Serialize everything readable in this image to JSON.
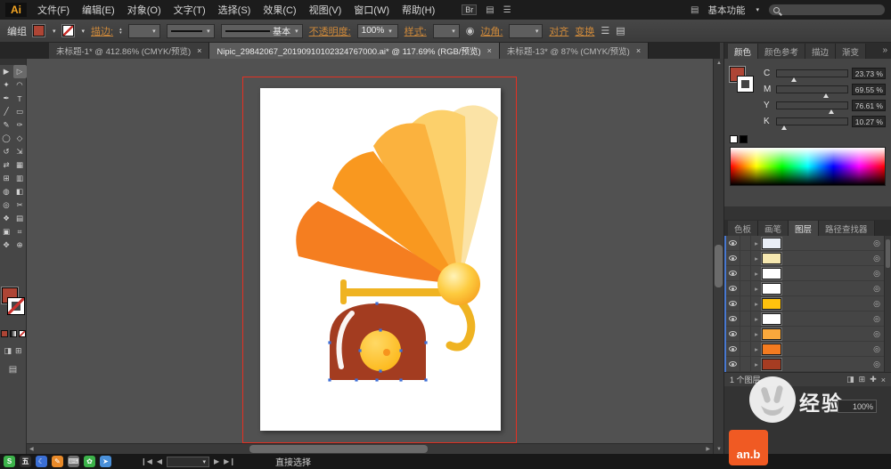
{
  "app": {
    "logo": "Ai",
    "workspace": "基本功能"
  },
  "menubar": {
    "items": [
      "文件(F)",
      "编辑(E)",
      "对象(O)",
      "文字(T)",
      "选择(S)",
      "效果(C)",
      "视图(V)",
      "窗口(W)",
      "帮助(H)"
    ]
  },
  "controlbar": {
    "object_label": "编组",
    "stroke_link": "描边:",
    "brush_name": "基本",
    "opacity_link": "不透明度:",
    "opacity_value": "100%",
    "style_link": "样式:",
    "corner_link": "边角:",
    "align_link": "对齐",
    "transform_link": "变换"
  },
  "doc_tabs": [
    {
      "title": "未标题-1* @ 412.86% (CMYK/预览)",
      "close": "×"
    },
    {
      "title": "Nipic_29842067_20190910102324767000.ai* @ 117.69% (RGB/预览)",
      "close": "×"
    },
    {
      "title": "未标题-13* @ 87% (CMYK/预览)",
      "close": "×"
    }
  ],
  "tools": {
    "glyphs": [
      "▶",
      "▷",
      "✦",
      "◠",
      "✒",
      "T",
      "╱",
      "▭",
      "✎",
      "✑",
      "◯",
      "◇",
      "↺",
      "⇲",
      "⇄",
      "▦",
      "⊞",
      "▥",
      "◍",
      "◧",
      "◎",
      "✂",
      "❖",
      "▤",
      "▣",
      "⌗",
      "✥",
      "⊕"
    ]
  },
  "color_panel": {
    "tabs": [
      "颜色",
      "颜色参考",
      "描边",
      "渐变"
    ],
    "fill_color": "#ae4535",
    "stroke_color": "#ffffff",
    "channels": [
      {
        "label": "C",
        "display": "23.73 %",
        "percent": "23.73%"
      },
      {
        "label": "M",
        "display": "69.55 %",
        "percent": "69.55%"
      },
      {
        "label": "Y",
        "display": "76.61 %",
        "percent": "76.61%"
      },
      {
        "label": "K",
        "display": "10.27 %",
        "percent": "10.27%"
      }
    ]
  },
  "layers_panel": {
    "tabs": [
      "色板",
      "画笔",
      "图层",
      "路径查找器"
    ],
    "rows": [
      {
        "color": "#e9eef6"
      },
      {
        "color": "#f6e8b0"
      },
      {
        "color": "#ffffff"
      },
      {
        "color": "#ffffff"
      },
      {
        "color": "#ffc20e"
      },
      {
        "color": "#ffffff"
      },
      {
        "color": "#f9a83c"
      },
      {
        "color": "#f47b20"
      },
      {
        "color": "#a63c22"
      }
    ],
    "footer_label": "1 个图层"
  },
  "artwork": {
    "petals": [
      "#fbe3a6",
      "#fcd06b",
      "#fbb23e",
      "#f9981f",
      "#f57e20"
    ],
    "sphere_inner": "#fff3b8",
    "sphere_mid": "#fdcb3f",
    "sphere_outer": "#f6a21f",
    "arm": "#efb322",
    "base": "#a33c20",
    "highlight": "#ffffff",
    "disc_light": "#ffd965",
    "disc": "#fcb514",
    "disc_dot": "#f7941d",
    "anchor": "#3e6fd6",
    "artboard_frame": "#e53022"
  },
  "statusbar": {
    "tool_name": "直接选择",
    "ime": [
      {
        "glyph": "S",
        "bg": "#3cb24a"
      },
      {
        "glyph": "五",
        "bg": "#2f2f2f"
      },
      {
        "glyph": "☾",
        "bg": "#3b6fd4"
      },
      {
        "glyph": "✎",
        "bg": "#e88a2a"
      },
      {
        "glyph": "⌨",
        "bg": "#6f6f6f"
      },
      {
        "glyph": "✿",
        "bg": "#3cb24a"
      },
      {
        "glyph": "➤",
        "bg": "#4a90d9"
      }
    ]
  },
  "watermark": {
    "text": "经验",
    "badge_text": "an.b",
    "badge_color": "#f05a23",
    "float_value": "100%"
  },
  "ui": {
    "caret": "▾",
    "spinner_up": "▴",
    "spinner_down": "▾",
    "menu_icon": "☰",
    "grid_icon": "▤",
    "bridge": "Br",
    "recolor_icon": "◉",
    "collapse": "»",
    "chevron": "▸",
    "target": "◎",
    "nav_first": "❙◀",
    "nav_prev": "◀",
    "nav_next": "▶",
    "nav_last": "▶❙",
    "scroll_up": "▲",
    "scroll_down": "▼",
    "scroll_left": "◀",
    "scroll_right": "▶",
    "footer_icons": [
      "◨",
      "⊞",
      "✚",
      "×"
    ]
  }
}
